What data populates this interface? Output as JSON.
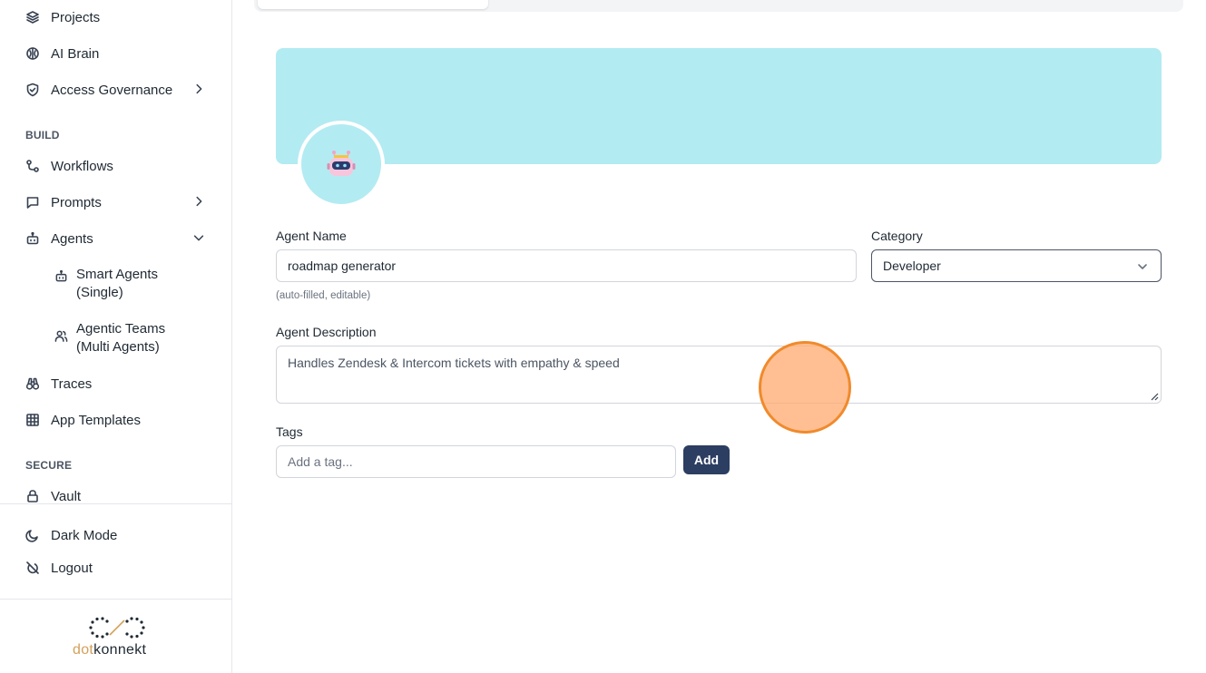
{
  "sidebar": {
    "top_items": [
      {
        "label": "Projects",
        "icon": "layers-icon"
      },
      {
        "label": "AI Brain",
        "icon": "brain-icon"
      },
      {
        "label": "Access Governance",
        "icon": "shield-icon"
      }
    ],
    "build_label": "BUILD",
    "build_items": [
      {
        "label": "Workflows",
        "icon": "workflow-icon"
      },
      {
        "label": "Prompts",
        "icon": "message-icon"
      },
      {
        "label": "Agents",
        "icon": "bot-icon"
      }
    ],
    "agents_sub": [
      {
        "label": "Smart Agents (Single)",
        "icon": "bot-icon"
      },
      {
        "label": "Agentic Teams (Multi Agents)",
        "icon": "users-icon"
      }
    ],
    "more_items": [
      {
        "label": "Traces",
        "icon": "binoculars-icon"
      },
      {
        "label": "App Templates",
        "icon": "grid-icon"
      }
    ],
    "secure_label": "SECURE",
    "secure_items": [
      {
        "label": "Vault",
        "icon": "lock-icon"
      }
    ],
    "bottom_items": [
      {
        "label": "Dark Mode",
        "icon": "moon-icon"
      },
      {
        "label": "Logout",
        "icon": "logout-icon"
      }
    ],
    "logo": {
      "dot": "dot",
      "konnekt": "konnekt"
    }
  },
  "form": {
    "agent_name_label": "Agent Name",
    "agent_name_value": "roadmap generator",
    "agent_name_hint": "(auto-filled, editable)",
    "category_label": "Category",
    "category_value": "Developer",
    "description_label": "Agent Description",
    "description_value": "Handles Zendesk & Intercom tickets with empathy & speed",
    "tags_label": "Tags",
    "tags_placeholder": "Add a tag...",
    "add_button": "Add"
  },
  "colors": {
    "banner": "#b3ebf2",
    "primary_button": "#2c3e61",
    "cursor_highlight": "#f08a2c"
  }
}
